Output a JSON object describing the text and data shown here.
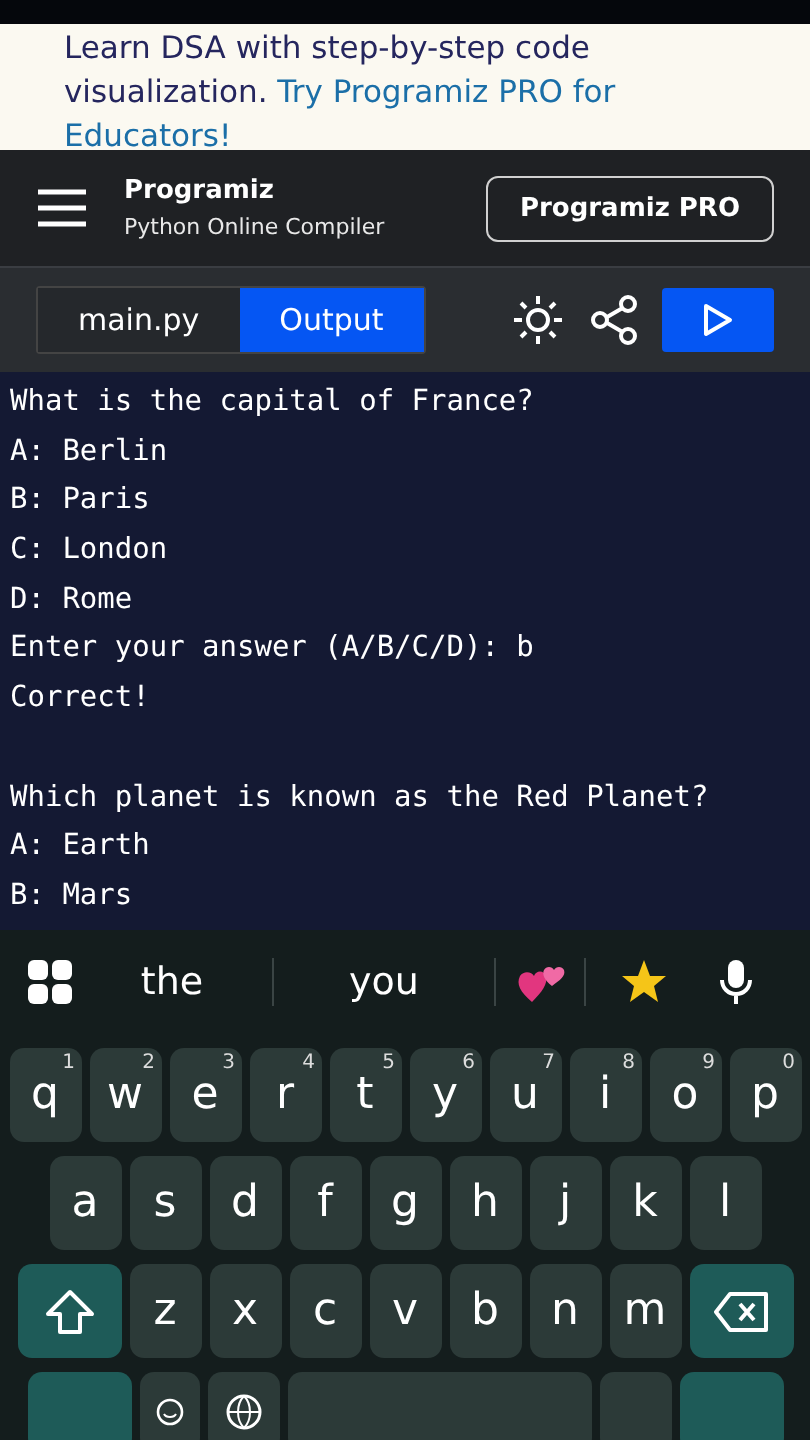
{
  "banner": {
    "text": "Learn DSA with step-by-step code visualization. ",
    "link_lines": [
      "Try Programiz PRO for",
      "Educators!"
    ]
  },
  "header": {
    "logo": "Programiz",
    "subtitle": "Python Online Compiler",
    "pro_button": "Programiz PRO"
  },
  "tabs": [
    {
      "label": "main.py",
      "selected": false
    },
    {
      "label": "Output",
      "selected": true
    }
  ],
  "output": [
    [
      "What is the capital of France?",
      "A: Berlin",
      "B: Paris",
      "C: London",
      "D: Rome",
      "Enter your answer (A/B/C/D): b",
      "Correct!"
    ],
    [
      "Which planet is known as the Red Planet?",
      "A: Earth",
      "B: Mars"
    ]
  ],
  "keyboard": {
    "suggestions": [
      "the",
      "you"
    ],
    "rows": [
      [
        {
          "kind": "letter",
          "label": "q",
          "hint": "1"
        },
        {
          "kind": "letter",
          "label": "w",
          "hint": "2"
        },
        {
          "kind": "letter",
          "label": "e",
          "hint": "3"
        },
        {
          "kind": "letter",
          "label": "r",
          "hint": "4"
        },
        {
          "kind": "letter",
          "label": "t",
          "hint": "5"
        },
        {
          "kind": "letter",
          "label": "y",
          "hint": "6"
        },
        {
          "kind": "letter",
          "label": "u",
          "hint": "7"
        },
        {
          "kind": "letter",
          "label": "i",
          "hint": "8"
        },
        {
          "kind": "letter",
          "label": "o",
          "hint": "9"
        },
        {
          "kind": "letter",
          "label": "p",
          "hint": "0"
        }
      ],
      [
        {
          "kind": "letter",
          "label": "a"
        },
        {
          "kind": "letter",
          "label": "s"
        },
        {
          "kind": "letter",
          "label": "d"
        },
        {
          "kind": "letter",
          "label": "f"
        },
        {
          "kind": "letter",
          "label": "g"
        },
        {
          "kind": "letter",
          "label": "h"
        },
        {
          "kind": "letter",
          "label": "j"
        },
        {
          "kind": "letter",
          "label": "k"
        },
        {
          "kind": "letter",
          "label": "l"
        }
      ],
      [
        {
          "kind": "shift"
        },
        {
          "kind": "letter",
          "label": "z"
        },
        {
          "kind": "letter",
          "label": "x"
        },
        {
          "kind": "letter",
          "label": "c"
        },
        {
          "kind": "letter",
          "label": "v"
        },
        {
          "kind": "letter",
          "label": "b"
        },
        {
          "kind": "letter",
          "label": "n"
        },
        {
          "kind": "letter",
          "label": "m"
        },
        {
          "kind": "backspace"
        }
      ]
    ]
  }
}
